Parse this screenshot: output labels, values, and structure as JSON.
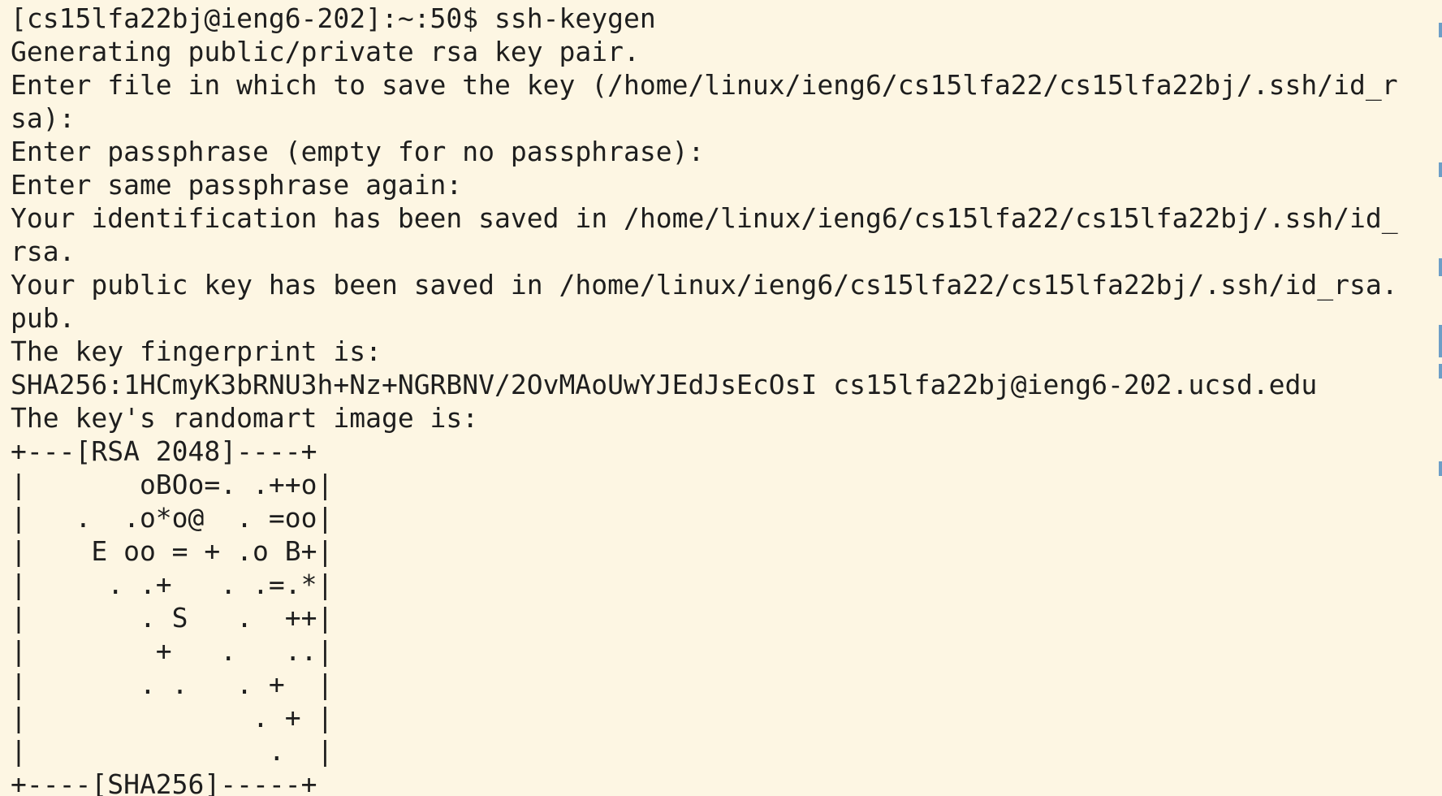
{
  "terminal": {
    "lines": [
      "[cs15lfa22bj@ieng6-202]:~:50$ ssh-keygen",
      "Generating public/private rsa key pair.",
      "Enter file in which to save the key (/home/linux/ieng6/cs15lfa22/cs15lfa22bj/.ssh/id_r",
      "sa):",
      "Enter passphrase (empty for no passphrase):",
      "Enter same passphrase again:",
      "Your identification has been saved in /home/linux/ieng6/cs15lfa22/cs15lfa22bj/.ssh/id_",
      "rsa.",
      "Your public key has been saved in /home/linux/ieng6/cs15lfa22/cs15lfa22bj/.ssh/id_rsa.",
      "pub.",
      "The key fingerprint is:",
      "SHA256:1HCmyK3bRNU3h+Nz+NGRBNV/2OvMAoUwYJEdJsEcOsI cs15lfa22bj@ieng6-202.ucsd.edu",
      "The key's randomart image is:",
      "+---[RSA 2048]----+",
      "|       oBOo=. .++o|",
      "|   .  .o*o@  . =oo|",
      "|    E oo = + .o B+|",
      "|     . .+   . .=.*|",
      "|       . S   .  ++|",
      "|        +   .   ..|",
      "|       . .   . +  |",
      "|              . + |",
      "|               .  |",
      "+----[SHA256]-----+"
    ]
  }
}
